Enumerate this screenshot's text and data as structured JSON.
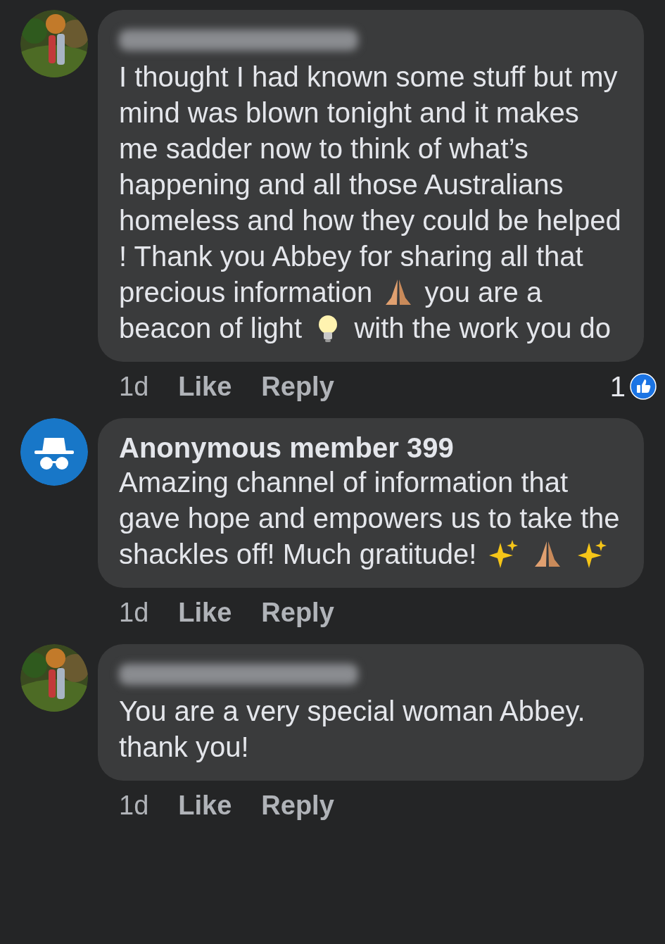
{
  "comments": [
    {
      "author_blurred": true,
      "body": [
        {
          "kind": "text",
          "text": "I thought I had known some stuff but my mind was blown tonight and it makes me sadder now to think of what’s happening and all those Australians homeless and how they could be helped ! Thank you Abbey for sharing all that precious information"
        },
        {
          "kind": "hands"
        },
        {
          "kind": "text",
          "text": "you are a beacon of light"
        },
        {
          "kind": "bulb"
        },
        {
          "kind": "text",
          "text": "with the work you do"
        }
      ],
      "time": "1d",
      "like": "Like",
      "reply": "Reply",
      "reactions": "1"
    },
    {
      "avatar": {
        "kind": "anonymous"
      },
      "author": "Anonymous member 399",
      "author_blurred": false,
      "body": [
        {
          "kind": "text",
          "text": "Amazing channel of information that gave hope and empowers us to take the shackles off! Much gratitude!"
        },
        {
          "kind": "sparkles"
        },
        {
          "kind": "hands"
        },
        {
          "kind": "sparkles"
        }
      ],
      "time": "1d",
      "like": "Like",
      "reply": "Reply"
    },
    {
      "author_blurred": true,
      "body": [
        {
          "kind": "text",
          "text": "You are a very special woman Abbey. thank you!"
        }
      ],
      "time": "1d",
      "like": "Like",
      "reply": "Reply"
    }
  ]
}
